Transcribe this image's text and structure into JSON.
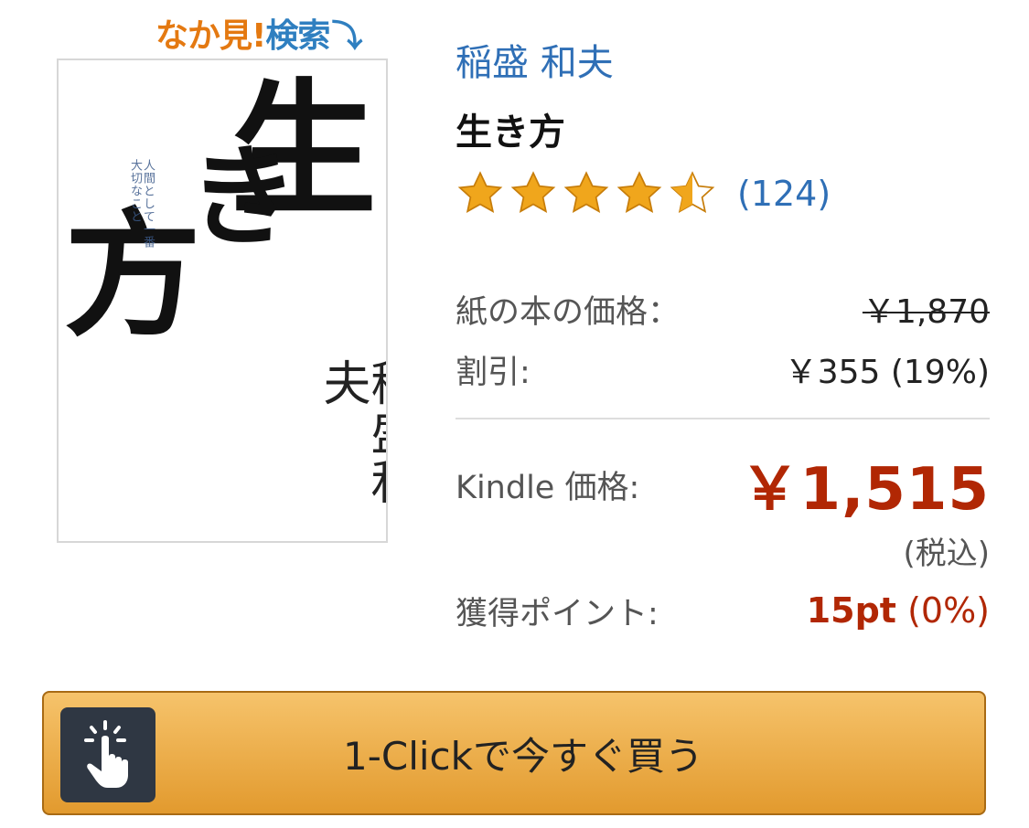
{
  "look_inside": {
    "part1": "なか見!",
    "part2": "検索",
    "arrow": "⤵"
  },
  "cover": {
    "title_chars": [
      "生",
      "き",
      "方"
    ],
    "subtitle": "人間として一番大切なこと",
    "author_vertical": "稲盛和夫"
  },
  "book": {
    "author": "稲盛 和夫",
    "title": "生き方",
    "rating": 4.5,
    "review_count": "(124)"
  },
  "pricing": {
    "paper_label": "紙の本の価格：",
    "paper_price": "￥1,870",
    "discount_label": "割引:",
    "discount_value": "￥355 (19%)",
    "kindle_label": "Kindle 価格:",
    "kindle_price": "￥1,515",
    "tax_note": "(税込)",
    "points_label": "獲得ポイント:",
    "points_value": "15pt",
    "points_pct": "(0%)"
  },
  "buy_button": {
    "label": "1-Clickで今すぐ買う",
    "icon": "tap-hand-icon"
  },
  "colors": {
    "link": "#2f6fb6",
    "price": "#b12704",
    "star": "#f0a61c",
    "button": "#e8a33c"
  }
}
